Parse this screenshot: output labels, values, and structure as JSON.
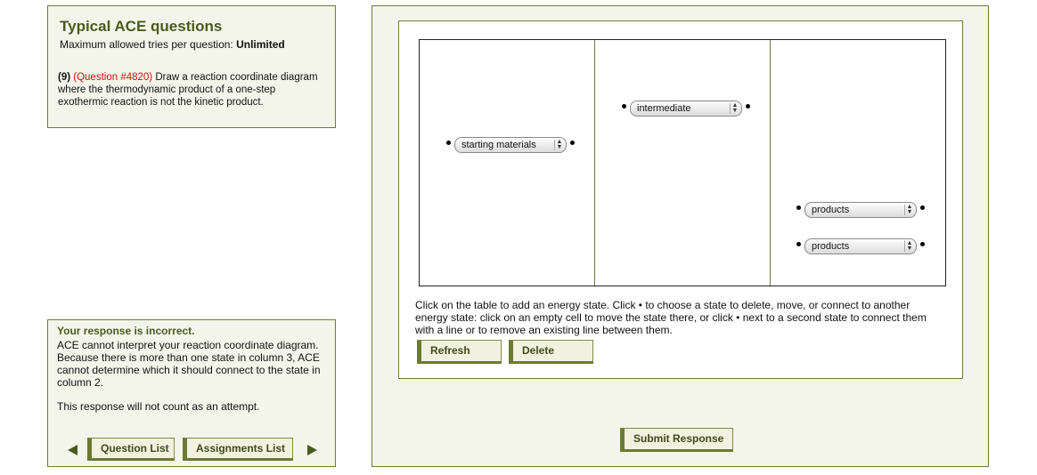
{
  "info": {
    "title": "Typical ACE questions",
    "tries_label": "Maximum allowed tries per question:",
    "tries_value": "Unlimited",
    "question_number": "(9)",
    "question_link": "(Question #4820)",
    "question_text": "Draw a reaction coordinate diagram where the thermodynamic product of a one-step exothermic reaction is not the kinetic product."
  },
  "feedback": {
    "title": "Your response is incorrect.",
    "body": "ACE cannot interpret your reaction coordinate diagram. Because there is more than one state in column 3, ACE cannot determine which it should connect to the state in column 2.",
    "note": "This response will not count as an attempt."
  },
  "nav": {
    "question_list": "Question List",
    "assignments_list": "Assignments List",
    "prev_icon": "left-arrow-icon",
    "next_icon": "right-arrow-icon"
  },
  "diagram": {
    "states": [
      {
        "column": 1,
        "label": "starting materials"
      },
      {
        "column": 2,
        "label": "intermediate"
      },
      {
        "column": 3,
        "label": "products"
      },
      {
        "column": 3,
        "label": "products"
      }
    ]
  },
  "instructions": "Click on the table to add an energy state. Click • to choose a state to delete, move, or connect to another energy state: click on an empty cell to move the state there, or click • next to a second state to connect them with a line or to remove an existing line between them.",
  "buttons": {
    "refresh": "Refresh",
    "delete": "Delete",
    "submit": "Submit Response"
  },
  "colors": {
    "accent": "#4a5a1f",
    "panel_bg": "#f4f5ea",
    "border": "#6f7a3e",
    "question_link": "#d01010"
  }
}
